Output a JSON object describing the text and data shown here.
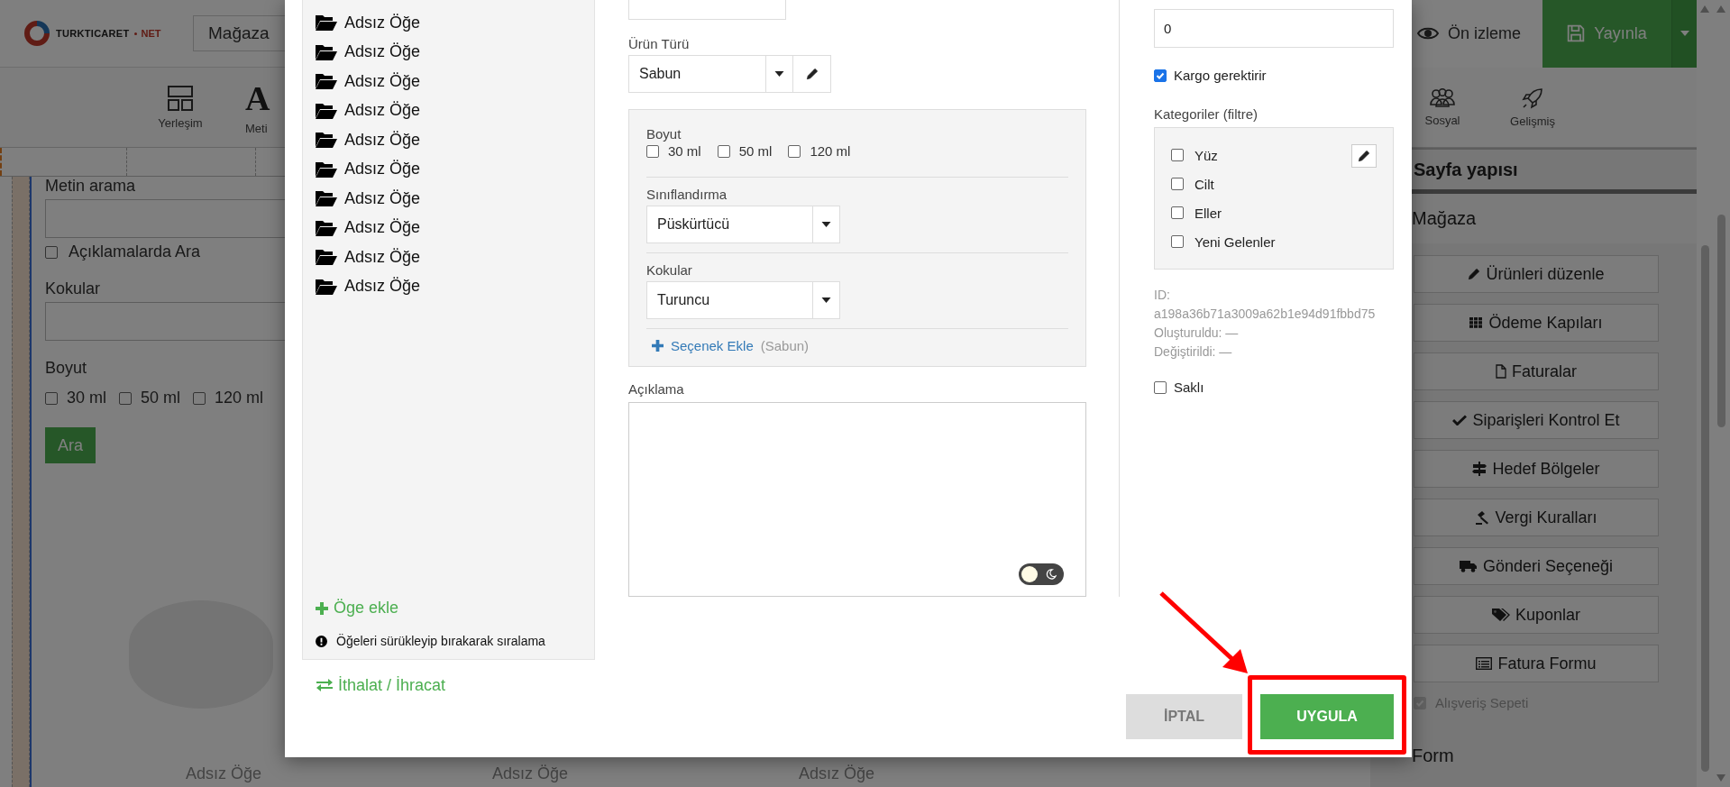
{
  "top_bar": {
    "logo_text": "TURKTICARET",
    "logo_suffix": "NET",
    "page_select": "Mağaza",
    "preview": "Ön izleme",
    "publish": "Yayınla"
  },
  "toolbar": {
    "layout_label": "Yerleşim",
    "text_glyph": "A",
    "text_label": "Meti",
    "social_label": "Sosyal",
    "advanced_label": "Gelişmiş"
  },
  "canvas": {
    "search_label": "Metin arama",
    "search_descriptions": {
      "label": "Açıklamalarda Ara",
      "checked": false
    },
    "scents_label": "Kokular",
    "size_label": "Boyut",
    "sizes": [
      {
        "label": "30 ml",
        "checked": false
      },
      {
        "label": "50 ml",
        "checked": false
      },
      {
        "label": "120 ml",
        "checked": false
      }
    ],
    "search_button": "Ara",
    "product_names": [
      "Adsız Öğe",
      "Adsız Öğe",
      "Adsız Öğe"
    ]
  },
  "sidebar": {
    "title": "Sayfa yapısı",
    "section": "Mağaza",
    "buttons": [
      "Ürünleri düzenle",
      "Ödeme Kapıları",
      "Faturalar",
      "Siparişleri Kontrol Et",
      "Hedef Bölgeler",
      "Vergi Kuralları",
      "Gönderi Seçeneği",
      "Kuponlar",
      "Fatura Formu"
    ],
    "cart": {
      "label": "Alışveriş Sepeti",
      "checked": true,
      "disabled": true
    },
    "next_section": "Form"
  },
  "modal": {
    "items": [
      "Adsız Öğe",
      "Adsız Öğe",
      "Adsız Öğe",
      "Adsız Öğe",
      "Adsız Öğe",
      "Adsız Öğe",
      "Adsız Öğe",
      "Adsız Öğe",
      "Adsız Öğe",
      "Adsız Öğe"
    ],
    "add_item": "Öge ekle",
    "hint": "Öğeleri sürükleyip bırakarak sıralama",
    "import_export": "İthalat / İhracat",
    "product_type": {
      "label": "Ürün Türü",
      "value": "Sabun"
    },
    "options": [
      {
        "kind": "checkboxes",
        "label": "Boyut",
        "choices": [
          {
            "label": "30 ml",
            "checked": false
          },
          {
            "label": "50 ml",
            "checked": false
          },
          {
            "label": "120 ml",
            "checked": false
          }
        ]
      },
      {
        "kind": "select",
        "label": "Sınıflandırma",
        "value": "Püskürtücü"
      },
      {
        "kind": "select",
        "label": "Kokular",
        "value": "Turuncu"
      }
    ],
    "add_option": "Seçenek Ekle",
    "add_option_context": "(Sabun)",
    "description": {
      "label": "Açıklama",
      "dark_mode": false
    },
    "weight": {
      "value": "0"
    },
    "requires_shipping": {
      "label": "Kargo gerektirir",
      "checked": true
    },
    "categories": {
      "label": "Kategoriler (filtre)",
      "items": [
        {
          "label": "Yüz",
          "checked": false
        },
        {
          "label": "Cilt",
          "checked": false
        },
        {
          "label": "Eller",
          "checked": false
        },
        {
          "label": "Yeni Gelenler",
          "checked": false
        }
      ]
    },
    "meta": [
      "ID:",
      "a198a36b71a3009a62b1e94d91fbbd75",
      "Oluşturuldu: —",
      "Değiştirildi: —"
    ],
    "hidden": {
      "label": "Saklı",
      "checked": false
    },
    "cancel": "İPTAL",
    "apply": "UYGULA"
  }
}
